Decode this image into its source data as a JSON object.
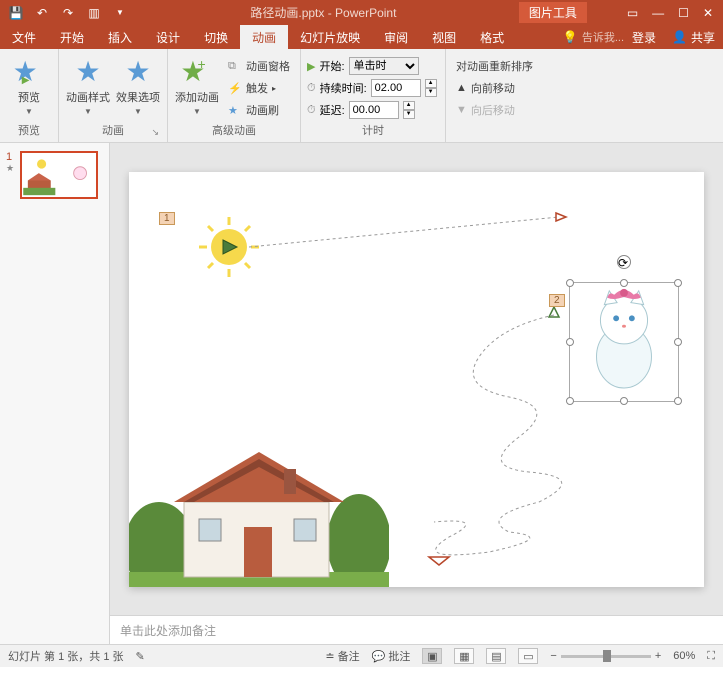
{
  "titlebar": {
    "docname": "路径动画.pptx - PowerPoint",
    "tools_tab": "图片工具"
  },
  "tabs": {
    "file": "文件",
    "home": "开始",
    "insert": "插入",
    "design": "设计",
    "transitions": "切换",
    "animations": "动画",
    "slideshow": "幻灯片放映",
    "review": "审阅",
    "view": "视图",
    "format": "格式",
    "tellme": "告诉我...",
    "login": "登录",
    "share": "共享"
  },
  "ribbon": {
    "preview": {
      "label": "预览",
      "btn": "预览"
    },
    "animation": {
      "label": "动画",
      "style": "动画样式",
      "options": "效果选项"
    },
    "advanced": {
      "label": "高级动画",
      "add": "添加动画",
      "pane": "动画窗格",
      "trigger": "触发",
      "painter": "动画刷"
    },
    "timing": {
      "label": "计时",
      "start": "开始:",
      "start_val": "单击时",
      "duration": "持续时间:",
      "duration_val": "02.00",
      "delay": "延迟:",
      "delay_val": "00.00"
    },
    "reorder": {
      "label": "对动画重新排序",
      "earlier": "向前移动",
      "later": "向后移动"
    }
  },
  "thumbnails": {
    "slide1_num": "1"
  },
  "slide": {
    "tag1": "1",
    "tag2": "2"
  },
  "notes": {
    "placeholder": "单击此处添加备注"
  },
  "statusbar": {
    "slide_info": "幻灯片 第 1 张，共 1 张",
    "notes": "备注",
    "comments": "批注",
    "zoom": "60%"
  }
}
